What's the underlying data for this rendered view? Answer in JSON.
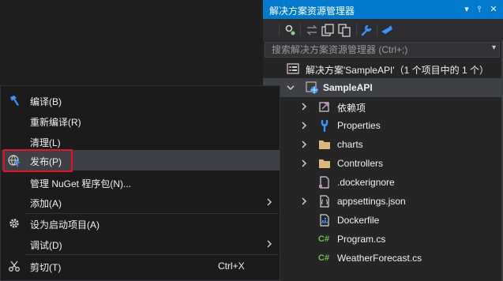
{
  "solution_explorer": {
    "title": "解决方案资源管理器",
    "title_buttons": [
      "▾",
      "⫯",
      "✕"
    ],
    "search_placeholder": "搜索解决方案资源管理器 (Ctrl+;)",
    "search_dropdown": "▾",
    "tree": {
      "solution_label": "解决方案'SampleAPI'（1 个项目中的 1 个）",
      "project_label": "SampleAPI",
      "items": [
        {
          "label": "依赖项",
          "icon": "dependencies-icon"
        },
        {
          "label": "Properties",
          "icon": "wrench-icon"
        },
        {
          "label": "charts",
          "icon": "folder-icon"
        },
        {
          "label": "Controllers",
          "icon": "folder-icon"
        },
        {
          "label": ".dockerignore",
          "icon": "file-icon"
        },
        {
          "label": "appsettings.json",
          "icon": "json-file-icon"
        },
        {
          "label": "Dockerfile",
          "icon": "dockerfile-icon"
        },
        {
          "label": "Program.cs",
          "icon": "csharp-file-icon"
        },
        {
          "label": "WeatherForecast.cs",
          "icon": "csharp-file-icon"
        }
      ]
    }
  },
  "context_menu": {
    "items": [
      {
        "label": "编译(B)",
        "icon": "hammer-icon"
      },
      {
        "label": "重新编译(R)"
      },
      {
        "label": "清理(L)"
      },
      {
        "label": "发布(P)",
        "icon": "globe-publish-icon",
        "highlighted": true
      },
      {
        "label": "管理 NuGet 程序包(N)..."
      },
      {
        "label": "添加(A)",
        "submenu": true
      },
      {
        "label": "设为启动项目(A)",
        "icon": "gear-icon"
      },
      {
        "label": "调试(D)",
        "submenu": true
      },
      {
        "label": "剪切(T)",
        "icon": "scissors-icon",
        "shortcut": "Ctrl+X"
      }
    ]
  },
  "colors": {
    "accent": "#007acc",
    "menu_background": "#1b1b1c",
    "panel_background": "#252526",
    "hover": "#3f3f46",
    "highlight_box": "#e81123",
    "csharp_green": "#6fbf4a"
  }
}
